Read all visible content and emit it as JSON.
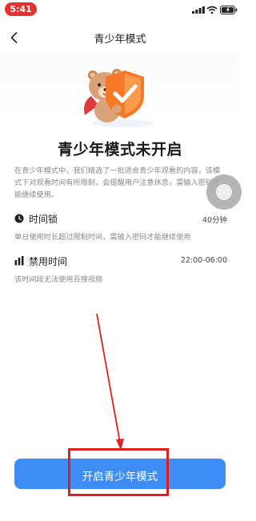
{
  "status_bar": {
    "time": "5:41"
  },
  "header": {
    "title": "青少年模式"
  },
  "hero": {
    "headline": "青少年模式未开启"
  },
  "description": "在青少年模式中，我们精选了一批适合青少年观看的内容，该模式下对观看时间有所限制，会提醒用户注意休息，需输入密码才能继续使用。",
  "time_lock": {
    "title": "时间锁",
    "value": "40分钟",
    "desc": "单日使用时长超过限制时间，需输入密码才能继续使用"
  },
  "disabled_time": {
    "title": "禁用时间",
    "value": "22:00-06:00",
    "desc": "该时间段无法使用百搜视频"
  },
  "cta": {
    "label": "开启青少年模式"
  },
  "colors": {
    "accent": "#3e8cf6",
    "annotation": "#e0201f",
    "status_pill": "#e5322e",
    "shield": "#f47a2a"
  },
  "icons": {
    "back": "chevron-left-icon",
    "time_lock": "clock-icon",
    "disabled_time": "bar-chart-icon"
  }
}
